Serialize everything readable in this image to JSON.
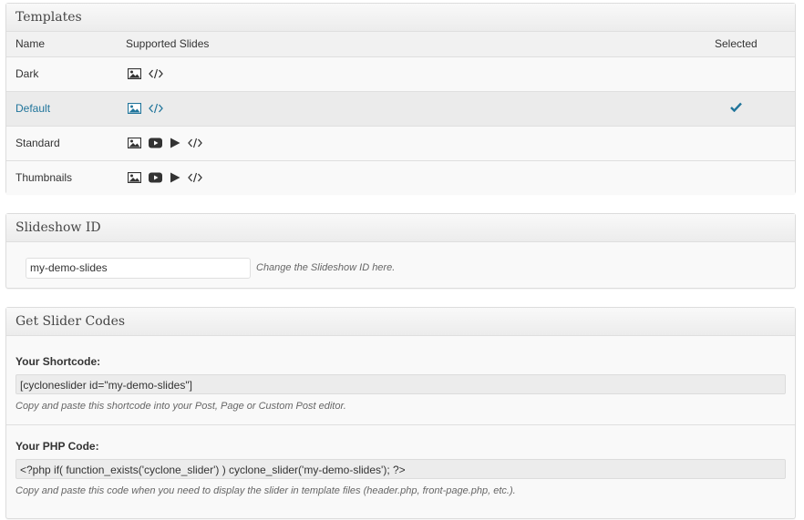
{
  "templates": {
    "title": "Templates",
    "columns": {
      "name": "Name",
      "supported": "Supported Slides",
      "selected": "Selected"
    },
    "rows": [
      {
        "name": "Dark",
        "icons": [
          "image-icon",
          "code-icon"
        ],
        "selected": false
      },
      {
        "name": "Default",
        "icons": [
          "image-icon",
          "code-icon"
        ],
        "selected": true
      },
      {
        "name": "Standard",
        "icons": [
          "image-icon",
          "youtube-icon",
          "play-icon",
          "code-icon"
        ],
        "selected": false
      },
      {
        "name": "Thumbnails",
        "icons": [
          "image-icon",
          "youtube-icon",
          "play-icon",
          "code-icon"
        ],
        "selected": false
      }
    ]
  },
  "slideshow": {
    "title": "Slideshow ID",
    "value": "my-demo-slides",
    "hint": "Change the Slideshow ID here."
  },
  "codes": {
    "title": "Get Slider Codes",
    "shortcode_label": "Your Shortcode:",
    "shortcode_value": "[cycloneslider id=\"my-demo-slides\"]",
    "shortcode_hint": "Copy and paste this shortcode into your Post, Page or Custom Post editor.",
    "php_label": "Your PHP Code:",
    "php_value": "<?php if( function_exists('cyclone_slider') ) cyclone_slider('my-demo-slides'); ?>",
    "php_hint": "Copy and paste this code when you need to display the slider in template files (header.php, front-page.php, etc.)."
  },
  "colors": {
    "link": "#21759b",
    "icon": "#333333",
    "active_row": "#ebebeb"
  }
}
